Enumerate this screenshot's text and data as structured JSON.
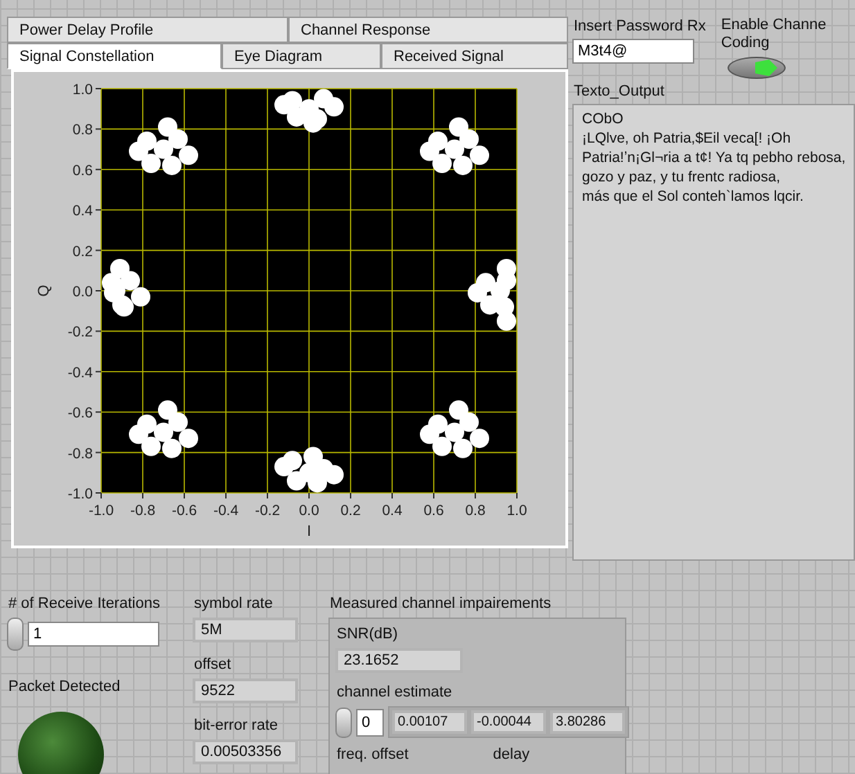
{
  "tabs_row_1": [
    {
      "label": "Power Delay Profile",
      "selected": false
    },
    {
      "label": "Channel Response",
      "selected": false
    }
  ],
  "tabs_row_2": [
    {
      "label": "Signal Constellation",
      "selected": true
    },
    {
      "label": "Eye Diagram",
      "selected": false
    },
    {
      "label": "Received Signal",
      "selected": false
    }
  ],
  "graph": {
    "chart_data": {
      "type": "scatter",
      "grid": true,
      "xlabel": "I",
      "ylabel": "Q",
      "xlim": [
        -1,
        1
      ],
      "ylim": [
        -1,
        1
      ],
      "xticks": [
        {
          "value": -1,
          "label": "-1.0"
        },
        {
          "value": -0.8,
          "label": "-0.8"
        },
        {
          "value": -0.6,
          "label": "-0.6"
        },
        {
          "value": -0.4,
          "label": "-0.4"
        },
        {
          "value": -0.2,
          "label": "-0.2"
        },
        {
          "value": 0,
          "label": "0.0"
        },
        {
          "value": 0.2,
          "label": "0.2"
        },
        {
          "value": 0.4,
          "label": "0.4"
        },
        {
          "value": 0.6,
          "label": "0.6"
        },
        {
          "value": 0.8,
          "label": "0.8"
        },
        {
          "value": 1,
          "label": "1.0"
        }
      ],
      "yticks": [
        {
          "value": -1,
          "label": "-1.0"
        },
        {
          "value": -0.8,
          "label": "-0.8"
        },
        {
          "value": -0.6,
          "label": "-0.6"
        },
        {
          "value": -0.4,
          "label": "-0.4"
        },
        {
          "value": -0.2,
          "label": "-0.2"
        },
        {
          "value": 0,
          "label": "0.0"
        },
        {
          "value": 0.2,
          "label": "0.2"
        },
        {
          "value": 0.4,
          "label": "0.4"
        },
        {
          "value": 0.6,
          "label": "0.6"
        },
        {
          "value": 0.8,
          "label": "0.8"
        },
        {
          "value": 1,
          "label": "1.0"
        }
      ],
      "x": [
        -0.7,
        -0.63,
        -0.78,
        -0.66,
        -0.76,
        -0.58,
        -0.82,
        -0.68,
        0,
        0.07,
        -0.08,
        0.04,
        -0.06,
        0.12,
        -0.12,
        0.02,
        0.7,
        0.77,
        0.62,
        0.74,
        0.64,
        0.82,
        0.58,
        0.72,
        0.92,
        0.95,
        0.85,
        0.94,
        0.87,
        0.95,
        0.81,
        0.95,
        0.7,
        0.77,
        0.62,
        0.74,
        0.64,
        0.82,
        0.58,
        0.72,
        0,
        0.07,
        -0.08,
        0.04,
        -0.06,
        0.12,
        -0.12,
        0.02,
        -0.7,
        -0.63,
        -0.78,
        -0.66,
        -0.76,
        -0.58,
        -0.82,
        -0.68,
        -0.93,
        -0.86,
        -0.95,
        -0.89,
        -0.9,
        -0.81,
        -0.94,
        -0.91
      ],
      "series": [
        {
          "color": "#ffffff",
          "values": [
            0.7,
            0.75,
            0.74,
            0.62,
            0.63,
            0.67,
            0.69,
            0.81,
            0.9,
            0.95,
            0.94,
            0.85,
            0.86,
            0.91,
            0.92,
            0.83,
            0.7,
            0.75,
            0.74,
            0.62,
            0.63,
            0.67,
            0.69,
            0.81,
            0,
            0.05,
            0.04,
            -0.08,
            -0.07,
            -0.15,
            -0.01,
            0.11,
            -0.7,
            -0.65,
            -0.66,
            -0.78,
            -0.77,
            -0.73,
            -0.71,
            -0.59,
            -0.9,
            -0.88,
            -0.84,
            -0.95,
            -0.94,
            -0.91,
            -0.87,
            -0.82,
            -0.7,
            -0.65,
            -0.66,
            -0.78,
            -0.77,
            -0.73,
            -0.71,
            -0.59,
            0,
            0.05,
            0.04,
            -0.08,
            -0.07,
            -0.03,
            -0.01,
            0.11
          ]
        }
      ]
    }
  },
  "password": {
    "label": "Insert Password Rx",
    "value": "M3t4@"
  },
  "channel_coding": {
    "label_lines": [
      "Enable Channe",
      "Coding"
    ],
    "on": true
  },
  "text_output": {
    "label": "Texto_Output",
    "lines": [
      "CObO",
      "¡LQlve, oh Patria,$Eil veca[! ¡Oh",
      "Patria!ʼn¡Gl¬ria a t¢! Ya tq pebho rebosa,",
      "gozo y paz, y tu frentc radiosa,",
      "más que el Sol conteh`lamos lqcir."
    ]
  },
  "iterations": {
    "label": "# of Receive Iterations",
    "value": "1"
  },
  "packet_detected": {
    "label": "Packet Detected",
    "on": false
  },
  "indicators": [
    {
      "label": "symbol rate",
      "value": "5M"
    },
    {
      "label": "offset",
      "value": "9522"
    },
    {
      "label": "bit-error rate",
      "value": "0.00503356"
    }
  ],
  "impairments": {
    "title": "Measured channel impairements",
    "snr_label": "SNR(dB)",
    "snr": "23.1652",
    "estimate_label": "channel estimate",
    "index": "0",
    "estimate": [
      "0.00107",
      "-0.00044",
      "3.80286"
    ],
    "freq_offset_label": "freq. offset",
    "delay_label": "delay"
  }
}
